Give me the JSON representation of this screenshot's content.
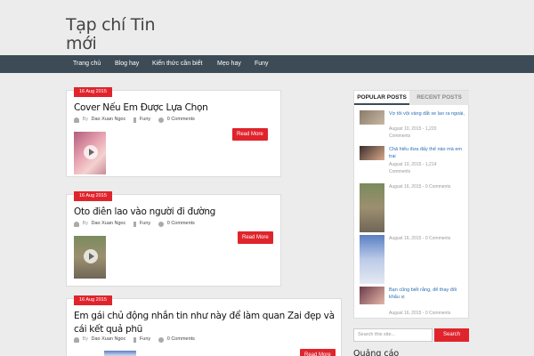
{
  "site": {
    "title": "Tạp chí Tin mới"
  },
  "nav": {
    "items": [
      "Trang chủ",
      "Blog hay",
      "Kiến thức cần biết",
      "Mẹo hay",
      "Funy"
    ]
  },
  "posts": [
    {
      "date": "16 Aug 2015",
      "title": "Cover Nếu Em Được Lựa Chọn",
      "by": "By",
      "author": "Dao Xuan Ngoc",
      "category": "Funy",
      "comments": "0 Comments",
      "read_more": "Read More"
    },
    {
      "date": "16 Aug 2015",
      "title": "Oto điên lao vào người đi đường",
      "by": "By",
      "author": "Dao Xuan Ngoc",
      "category": "Funy",
      "comments": "0 Comments",
      "read_more": "Read More"
    },
    {
      "date": "16 Aug 2015",
      "title": "Em gái chủ động nhắn tin như này để làm quan Zai đẹp và cái kết quả phũ",
      "by": "By",
      "author": "Dao Xuan Ngoc",
      "category": "Funy",
      "comments": "0 Comments",
      "read_more": "Read More"
    }
  ],
  "sidebar": {
    "tabs": [
      "POPULAR POSTS",
      "RECENT POSTS"
    ],
    "popular": [
      {
        "title": "Vợ tôi vội vàng dắt xe lao ra ngoài,",
        "meta1": "August 10, 2015 - 1,220",
        "meta2": "Comments"
      },
      {
        "title": "Chả hiểu đưa đấy thế nào mà em trai",
        "meta1": "August 10, 2015 - 1,214",
        "meta2": "Comments"
      },
      {
        "title": "",
        "meta1": "August 16, 2015 - 0 Comments",
        "meta2": ""
      },
      {
        "title": "",
        "meta1": "August 16, 2015 - 0 Comments",
        "meta2": ""
      },
      {
        "title": "Bạn cũng biết rằng, để thay đổi khẩu vị",
        "meta1": "August 16, 2015 - 0 Comments",
        "meta2": ""
      }
    ]
  },
  "search": {
    "placeholder": "Search this site...",
    "button": "Search"
  },
  "widget": {
    "title": "Quảng cáo"
  },
  "colors": {
    "accent": "#e0242c",
    "nav_bg": "#3c4b56",
    "link": "#2a6fb5",
    "page_bg": "#ececec"
  }
}
